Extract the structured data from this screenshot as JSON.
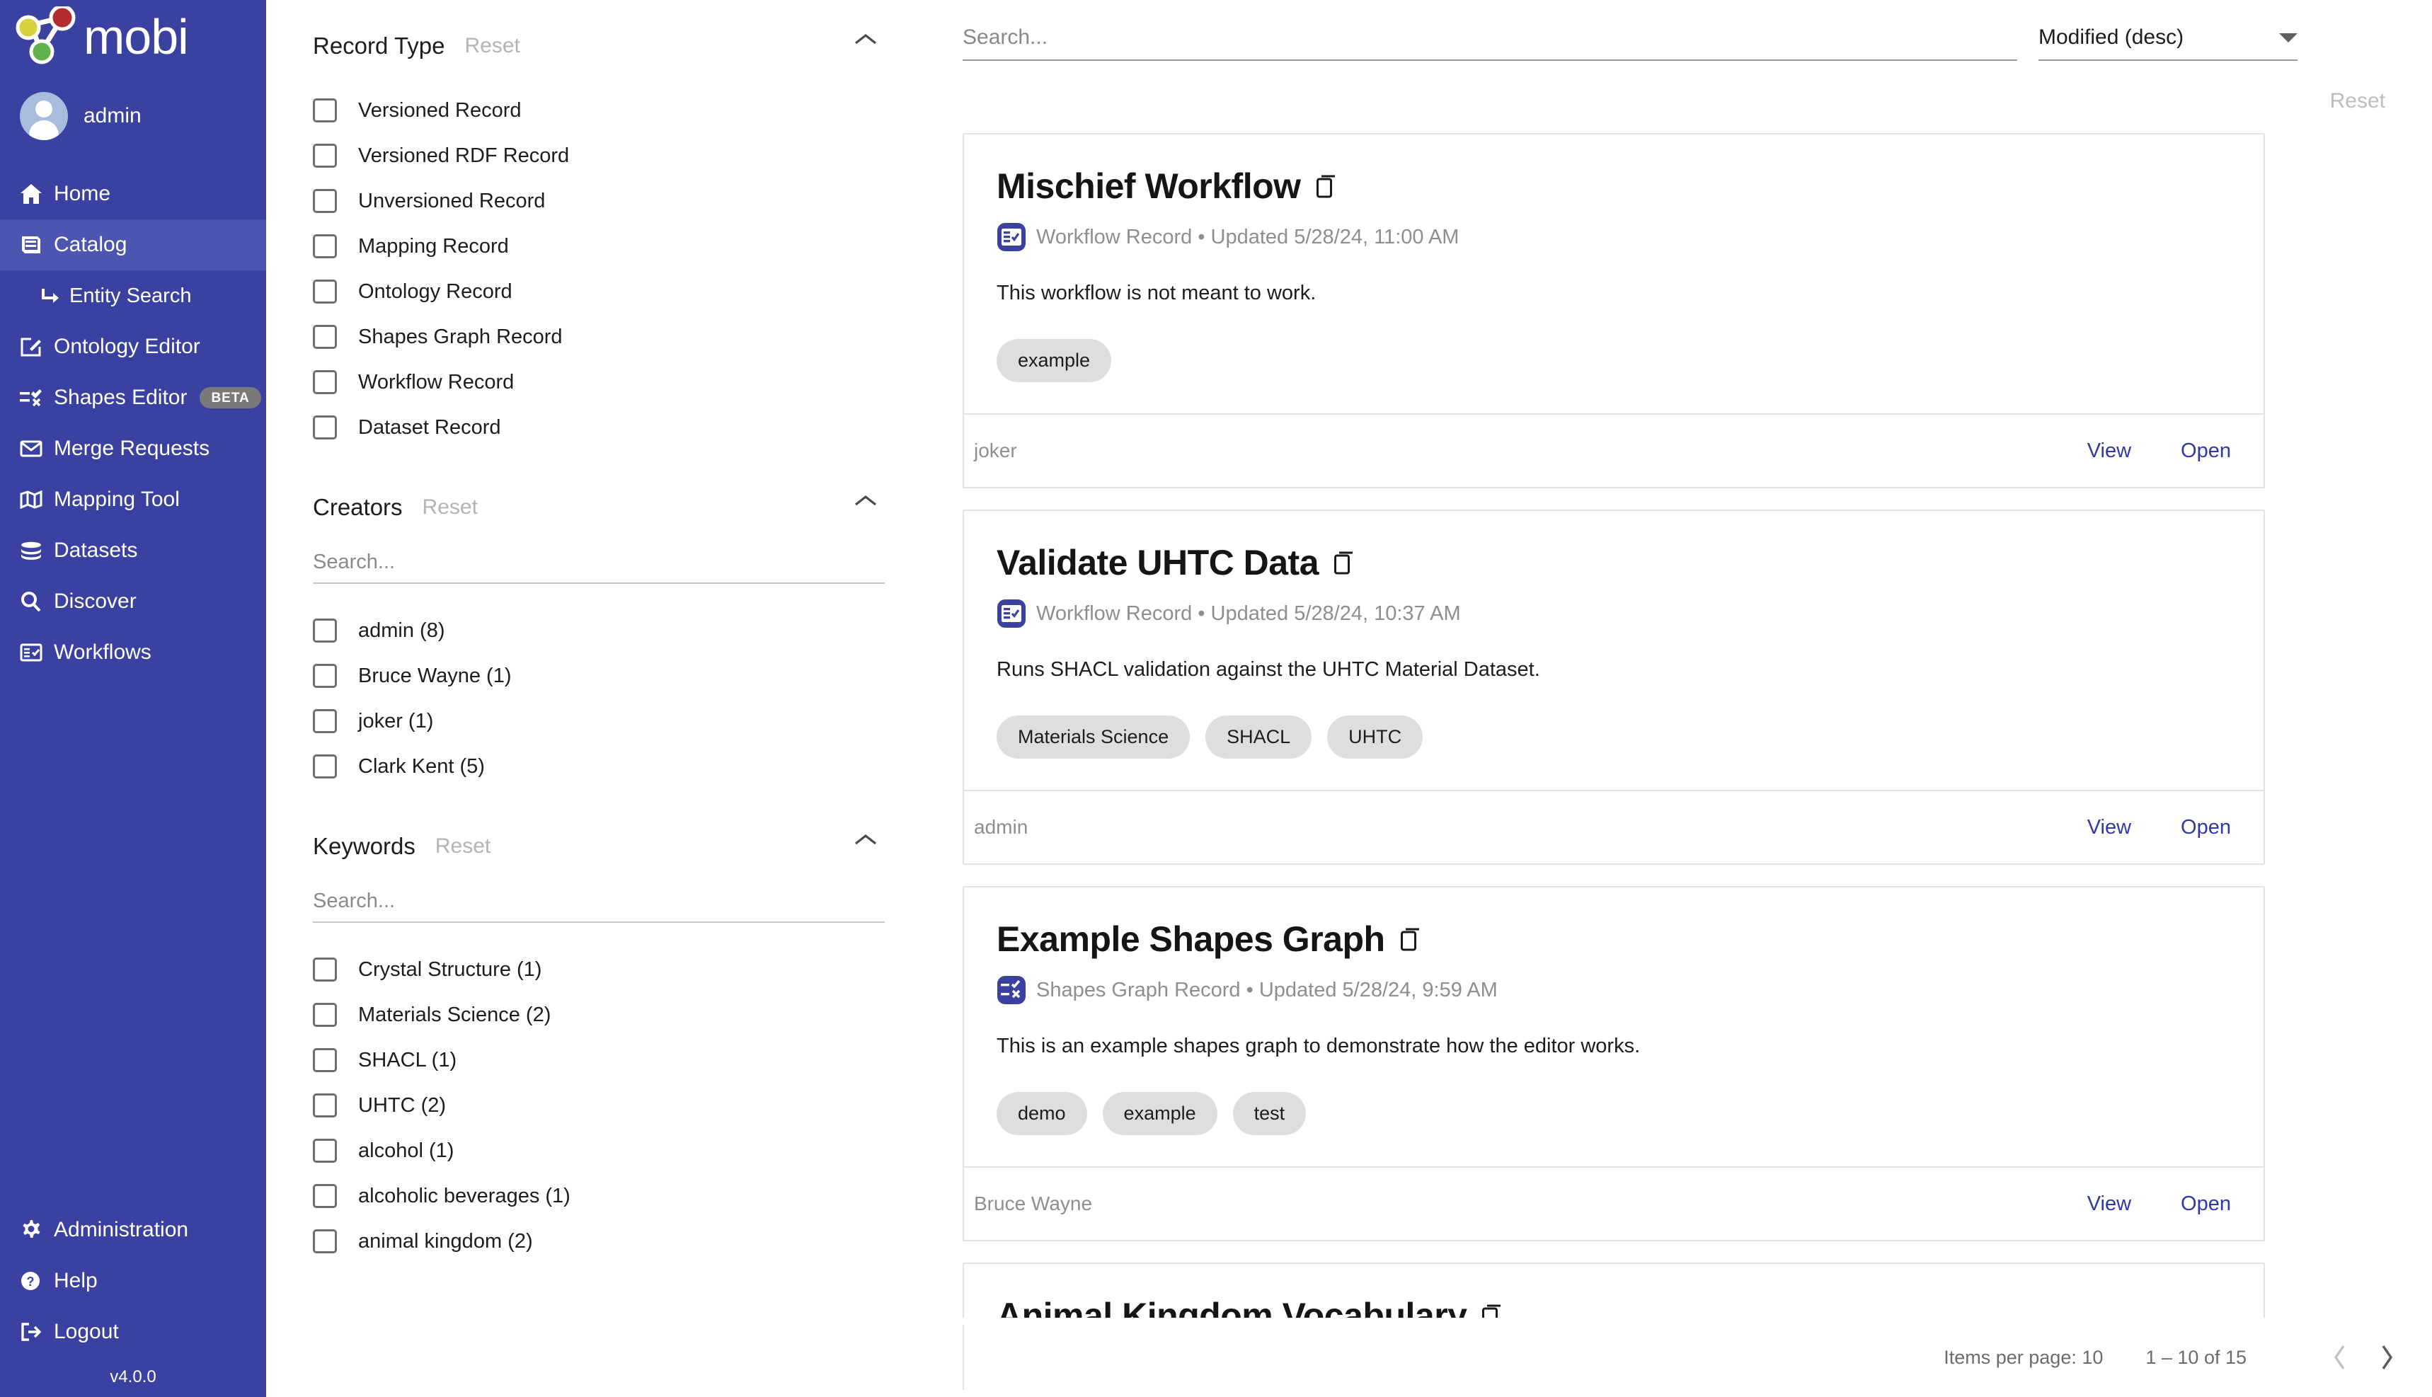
{
  "brand": {
    "name": "mobi",
    "version": "v4.0.0"
  },
  "user": {
    "name": "admin"
  },
  "sidebar": {
    "items": [
      {
        "label": "Home",
        "icon": "home-icon",
        "active": false,
        "sub": false
      },
      {
        "label": "Catalog",
        "icon": "book-icon",
        "active": true,
        "sub": false
      },
      {
        "label": "Entity Search",
        "icon": "arrow-turn-icon",
        "active": false,
        "sub": true
      },
      {
        "label": "Ontology Editor",
        "icon": "pencil-square-icon",
        "active": false,
        "sub": false
      },
      {
        "label": "Shapes Editor",
        "icon": "shapes-icon",
        "active": false,
        "sub": false,
        "badge": "BETA"
      },
      {
        "label": "Merge Requests",
        "icon": "envelope-icon",
        "active": false,
        "sub": false
      },
      {
        "label": "Mapping Tool",
        "icon": "map-icon",
        "active": false,
        "sub": false
      },
      {
        "label": "Datasets",
        "icon": "database-icon",
        "active": false,
        "sub": false
      },
      {
        "label": "Discover",
        "icon": "search-icon",
        "active": false,
        "sub": false
      },
      {
        "label": "Workflows",
        "icon": "workflow-icon",
        "active": false,
        "sub": false
      }
    ],
    "bottom_items": [
      {
        "label": "Administration",
        "icon": "gear-icon"
      },
      {
        "label": "Help",
        "icon": "question-circle-icon"
      },
      {
        "label": "Logout",
        "icon": "logout-icon"
      }
    ]
  },
  "filters": {
    "record_type": {
      "title": "Record Type",
      "reset_label": "Reset",
      "options": [
        {
          "label": "Versioned Record",
          "checked": false
        },
        {
          "label": "Versioned RDF Record",
          "checked": false
        },
        {
          "label": "Unversioned Record",
          "checked": false
        },
        {
          "label": "Mapping Record",
          "checked": false
        },
        {
          "label": "Ontology Record",
          "checked": false
        },
        {
          "label": "Shapes Graph Record",
          "checked": false
        },
        {
          "label": "Workflow Record",
          "checked": false
        },
        {
          "label": "Dataset Record",
          "checked": false
        }
      ]
    },
    "creators": {
      "title": "Creators",
      "reset_label": "Reset",
      "search_placeholder": "Search...",
      "search_value": "",
      "options": [
        {
          "label": "admin (8)",
          "checked": false
        },
        {
          "label": "Bruce Wayne (1)",
          "checked": false
        },
        {
          "label": "joker (1)",
          "checked": false
        },
        {
          "label": "Clark Kent (5)",
          "checked": false
        }
      ]
    },
    "keywords": {
      "title": "Keywords",
      "reset_label": "Reset",
      "search_placeholder": "Search...",
      "search_value": "",
      "options": [
        {
          "label": "Crystal Structure (1)",
          "checked": false
        },
        {
          "label": "Materials Science (2)",
          "checked": false
        },
        {
          "label": "SHACL (1)",
          "checked": false
        },
        {
          "label": "UHTC (2)",
          "checked": false
        },
        {
          "label": "alcohol (1)",
          "checked": false
        },
        {
          "label": "alcoholic beverages (1)",
          "checked": false
        },
        {
          "label": "animal kingdom (2)",
          "checked": false
        }
      ]
    }
  },
  "toolbar": {
    "search_placeholder": "Search...",
    "search_value": "",
    "sort_value": "Modified (desc)",
    "reset_label": "Reset"
  },
  "records": [
    {
      "title": "Mischief Workflow",
      "type": "Workflow Record",
      "type_icon": "workflow-record-icon",
      "updated": "Updated 5/28/24, 11:00 AM",
      "separator": "•",
      "description": "This workflow is not meant to work.",
      "tags": [
        "example"
      ],
      "creator": "joker",
      "actions": [
        "View",
        "Open"
      ]
    },
    {
      "title": "Validate UHTC Data",
      "type": "Workflow Record",
      "type_icon": "workflow-record-icon",
      "updated": "Updated 5/28/24, 10:37 AM",
      "separator": "•",
      "description": "Runs SHACL validation against the UHTC Material Dataset.",
      "tags": [
        "Materials Science",
        "SHACL",
        "UHTC"
      ],
      "creator": "admin",
      "actions": [
        "View",
        "Open"
      ]
    },
    {
      "title": "Example Shapes Graph",
      "type": "Shapes Graph Record",
      "type_icon": "shapes-graph-record-icon",
      "updated": "Updated 5/28/24, 9:59 AM",
      "separator": "•",
      "description": "This is an example shapes graph to demonstrate how the editor works.",
      "tags": [
        "demo",
        "example",
        "test"
      ],
      "creator": "Bruce Wayne",
      "actions": [
        "View",
        "Open"
      ]
    },
    {
      "title": "Animal Kingdom Vocabulary",
      "type": "",
      "type_icon": "",
      "updated": "",
      "separator": "",
      "description": "",
      "tags": [],
      "creator": "",
      "actions": []
    }
  ],
  "paginator": {
    "items_per_page_label": "Items per page: 10",
    "range_label": "1 – 10 of 15",
    "prev_icon": "chevron-left-icon",
    "next_icon": "chevron-right-icon"
  },
  "colors": {
    "sidebar": "#3a41a0",
    "sidebar_active": "#4c55b0",
    "accent_link": "#3038a8",
    "tag_bg": "#dedede",
    "muted_text": "#8e8e8e",
    "logo_red": "#b32d2e",
    "logo_yellow": "#d6d13c",
    "logo_green": "#5fb24a"
  }
}
